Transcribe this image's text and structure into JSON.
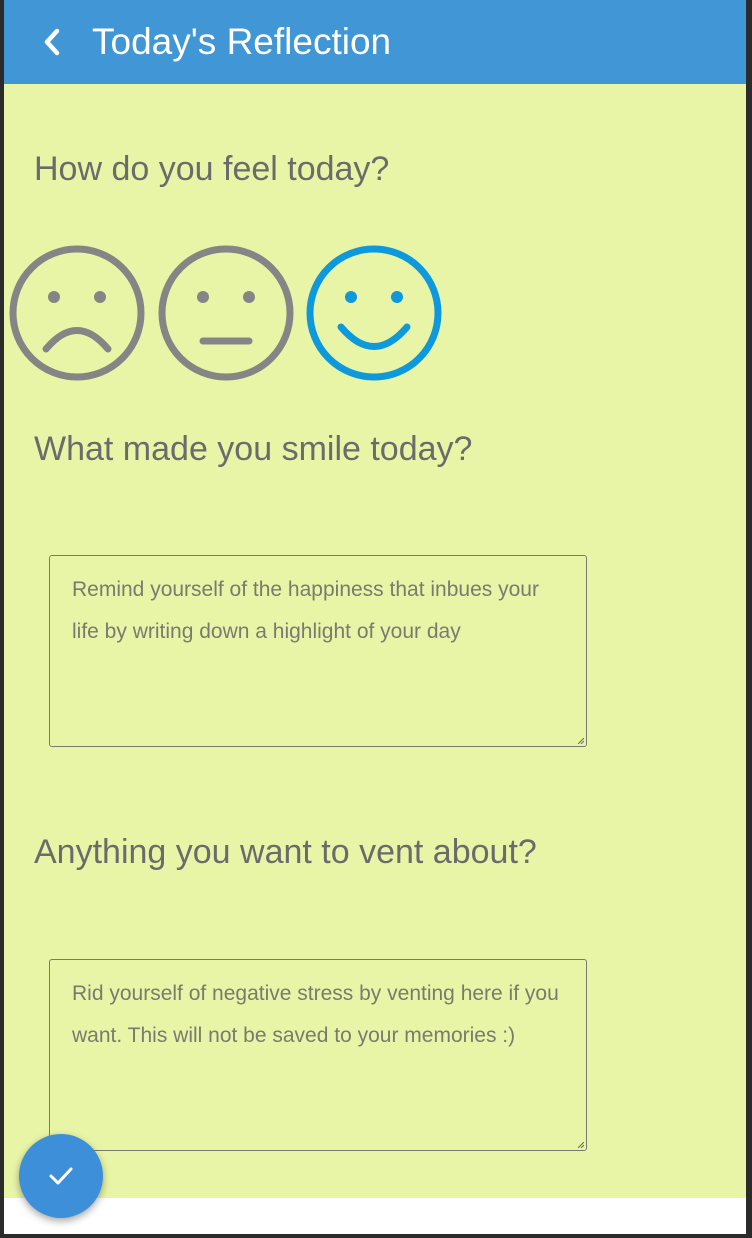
{
  "header": {
    "title": "Today's Reflection",
    "back_icon": "chevron-left-icon",
    "background_color": "#4196d6"
  },
  "mood": {
    "question": "How do you feel today?",
    "options": [
      {
        "name": "sad",
        "icon": "sad-face-icon",
        "selected": false
      },
      {
        "name": "neutral",
        "icon": "neutral-face-icon",
        "selected": false
      },
      {
        "name": "happy",
        "icon": "happy-face-icon",
        "selected": true
      }
    ],
    "selected_color": "#0d99db",
    "unselected_color": "#858585"
  },
  "smile": {
    "question": "What made you smile today?",
    "placeholder": "Remind yourself of the happiness that inbues your life by writing down a highlight of your day",
    "value": ""
  },
  "vent": {
    "question": "Anything you want to vent about?",
    "placeholder": "Rid yourself of negative stress by venting here if you want. This will not be saved to your memories :)",
    "value": ""
  },
  "fab": {
    "icon": "checkmark-icon",
    "color": "#3d8fd9"
  },
  "content_background": "#e9f5a6"
}
